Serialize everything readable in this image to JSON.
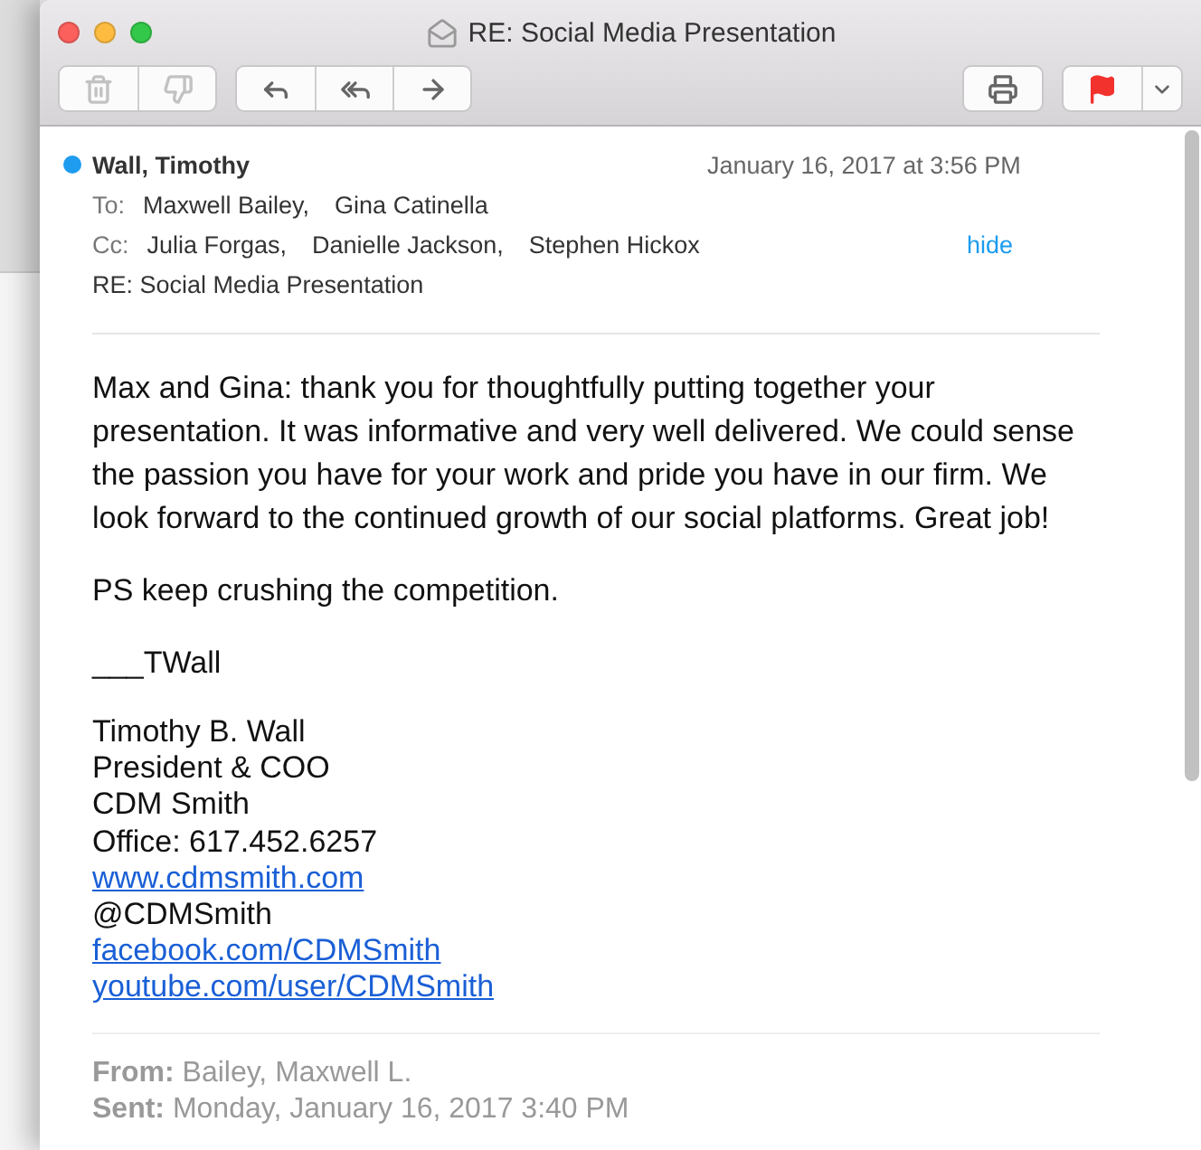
{
  "window": {
    "title": "RE: Social Media Presentation"
  },
  "toolbar": [
    {
      "buttons": [
        {
          "kind": "delete",
          "disabled": true
        },
        {
          "kind": "junk",
          "disabled": true
        }
      ]
    },
    {
      "buttons": [
        {
          "kind": "reply",
          "disabled": false
        },
        {
          "kind": "reply-all",
          "disabled": false
        },
        {
          "kind": "forward",
          "disabled": false
        }
      ]
    },
    {
      "buttons": [
        {
          "kind": "print",
          "disabled": false
        }
      ]
    },
    {
      "buttons": [
        {
          "kind": "flag",
          "disabled": false
        },
        {
          "kind": "menu",
          "disabled": false
        }
      ]
    }
  ],
  "message": {
    "unread": true,
    "sender": "Wall, Timothy",
    "date": "January 16, 2017 at 3:56 PM",
    "to_label": "To:",
    "to": [
      "Maxwell Bailey,",
      "Gina Catinella"
    ],
    "cc_label": "Cc:",
    "cc": [
      "Julia Forgas,",
      "Danielle Jackson,",
      "Stephen Hickox"
    ],
    "hide_link": "hide",
    "subject": "RE: Social Media Presentation"
  },
  "body": {
    "paragraphs": [
      "Max and Gina: thank you for thoughtfully putting together your presentation. It was informative and very well delivered. We could sense the passion you have for your work and pride you have in our firm. We look forward to the continued growth of our social platforms. Great job!",
      "PS keep crushing the competition.",
      "___TWall"
    ],
    "signature": [
      {
        "kind": "text",
        "text": "Timothy B. Wall"
      },
      {
        "kind": "text",
        "text": "President & COO"
      },
      {
        "kind": "text",
        "text": "CDM Smith"
      },
      {
        "kind": "text",
        "text": "Office: 617.452.6257"
      },
      {
        "kind": "link",
        "text": "www.cdmsmith.com"
      },
      {
        "kind": "text",
        "text": "@CDMSmith"
      },
      {
        "kind": "link",
        "text": "facebook.com/CDMSmith"
      },
      {
        "kind": "link",
        "text": "youtube.com/user/CDMSmith"
      }
    ]
  },
  "quoted": [
    {
      "label": "From:",
      "value": "Bailey, Maxwell L."
    },
    {
      "label": "Sent:",
      "value": "Monday, January 16, 2017 3:40 PM"
    }
  ]
}
